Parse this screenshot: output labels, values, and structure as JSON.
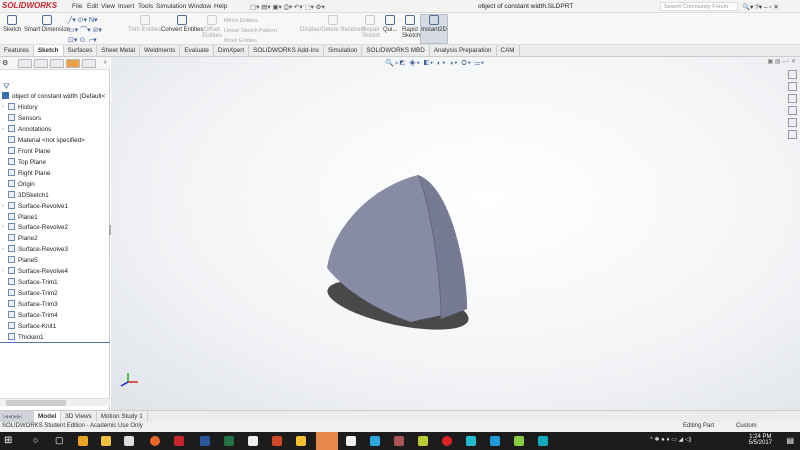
{
  "app": {
    "logo": "SOLIDWORKS",
    "document_title": "object of constant width.SLDPRT",
    "search_placeholder": "Search Community Forum"
  },
  "menu": [
    "File",
    "Edit",
    "View",
    "Insert",
    "Tools",
    "Simulation",
    "Window",
    "Help"
  ],
  "commands": {
    "sketch": "Sketch",
    "smart_dimension": "Smart Dimension",
    "trim_entities": "Trim Entities",
    "convert_entities": "Convert Entities",
    "offset_entities": "Offset Entities",
    "mirror_entities": "Mirror Entities",
    "linear_pattern": "Linear Sketch Pattern",
    "move_entities": "Move Entities",
    "display_delete_relations": "Display/Delete Relations",
    "repair_sketch": "Repair Sketch",
    "quick_snaps": "Qui...",
    "rapid_sketch": "Rapid Sketch",
    "instant2d": "Instant2D"
  },
  "tabs": [
    {
      "label": "Features"
    },
    {
      "label": "Sketch",
      "active": true
    },
    {
      "label": "Surfaces"
    },
    {
      "label": "Sheet Metal"
    },
    {
      "label": "Weldments"
    },
    {
      "label": "Evaluate"
    },
    {
      "label": "DimXpert"
    },
    {
      "label": "SOLIDWORKS Add-Ins"
    },
    {
      "label": "Simulation"
    },
    {
      "label": "SOLIDWORKS MBD"
    },
    {
      "label": "Analysis Preparation"
    },
    {
      "label": "CAM"
    }
  ],
  "tree": {
    "root": "object of constant width  (Default<",
    "items": [
      {
        "label": "History",
        "exp": true
      },
      {
        "label": "Sensors"
      },
      {
        "label": "Annotations",
        "exp": true
      },
      {
        "label": "Material <not specified>"
      },
      {
        "label": "Front Plane"
      },
      {
        "label": "Top Plane"
      },
      {
        "label": "Right Plane"
      },
      {
        "label": "Origin"
      },
      {
        "label": "3DSketch1"
      },
      {
        "label": "Surface-Revolve1",
        "exp": true
      },
      {
        "label": "Plane1"
      },
      {
        "label": "Surface-Revolve2",
        "exp": true
      },
      {
        "label": "Plane2"
      },
      {
        "label": "Surface-Revolve3",
        "exp": true
      },
      {
        "label": "Plane5"
      },
      {
        "label": "Surface-Revolve4",
        "exp": true
      },
      {
        "label": "Surface-Trim1"
      },
      {
        "label": "Surface-Trim2"
      },
      {
        "label": "Surface-Trim3"
      },
      {
        "label": "Surface-Trim4"
      },
      {
        "label": "Surface-Knit1"
      },
      {
        "label": "Thicken1"
      }
    ]
  },
  "view_tabs": [
    {
      "label": "Model",
      "active": true
    },
    {
      "label": "3D Views"
    },
    {
      "label": "Motion Study 1"
    }
  ],
  "status": {
    "left": "SOLIDWORKS Student Edition - Academic Use Only",
    "mode": "Editing Part",
    "units": "Custom"
  },
  "clock": {
    "time": "1:24 PM",
    "date": "5/5/2017"
  },
  "colors": {
    "part": "#8a8fa8",
    "brand": "#c8262d"
  }
}
